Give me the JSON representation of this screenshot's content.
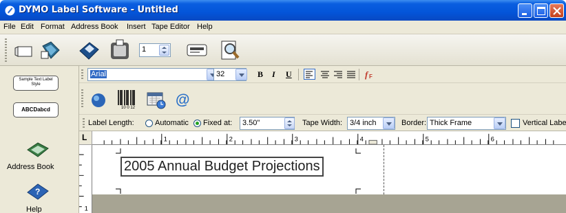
{
  "window": {
    "title": "DYMO Label Software - Untitled"
  },
  "menu": [
    "File",
    "Edit",
    "Format",
    "Address Book",
    "Insert",
    "Tape Editor",
    "Help"
  ],
  "toolbar": {
    "icons": [
      "new-label-icon",
      "open-icon",
      "save-icon",
      "print-icon",
      "print-preview-icon"
    ],
    "copies": "1"
  },
  "sidebar": {
    "style_samples": [
      "Sample Text Label Style",
      "ABCDabcd"
    ],
    "items": [
      {
        "label": "Address Book",
        "icon": "address-book-icon"
      },
      {
        "label": "Help",
        "icon": "help-icon"
      }
    ]
  },
  "format_bar": {
    "font": "Arial",
    "size": "32",
    "bold": "B",
    "italic": "I",
    "underline": "U"
  },
  "insert_bar": {
    "icons": [
      "clip-art-icon",
      "barcode-icon",
      "date-time-icon",
      "address-at-icon"
    ],
    "barcode_caption": "10 0 12"
  },
  "label_bar": {
    "length_label": "Label Length:",
    "automatic": "Automatic",
    "fixed": "Fixed at:",
    "fixed_value": "3.50\"",
    "tape_width_label": "Tape Width:",
    "tape_width": "3/4 inch",
    "border_label": "Border:",
    "border": "Thick Frame",
    "vertical": "Vertical Label",
    "length_mode": "fixed"
  },
  "ruler": {
    "marks": [
      "1",
      "2",
      "3",
      "4",
      "5",
      "6"
    ],
    "vmark": "1",
    "corner": "L"
  },
  "label": {
    "text": "2005 Annual Budget Projections"
  }
}
